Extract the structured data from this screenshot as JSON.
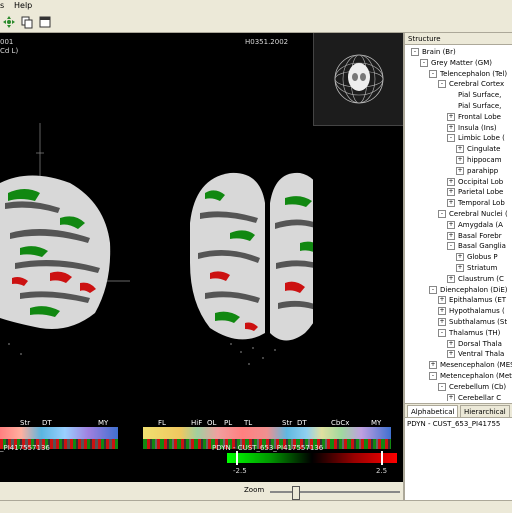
{
  "menu": {
    "items": [
      "s",
      "Help"
    ]
  },
  "viewer": {
    "left_label_top": "001",
    "left_label_sub": "Cd L)",
    "center_label": "H0351.2002",
    "ontology": {
      "left_labels": [
        "Str",
        "DT",
        "MY"
      ],
      "right_labels": [
        "FL",
        "HiF",
        "OL",
        "PL",
        "TL",
        "Str",
        "DT",
        "CbCx",
        "MY"
      ]
    },
    "gene_left": "_PI417557136",
    "gene_right": "PDYN - CUST_653_PI417557136",
    "scale_min": "-2.5",
    "scale_max": "2.5",
    "zoom_label": "Zoom",
    "zoom_level": 0.18
  },
  "panel": {
    "header": "Structure",
    "tree": [
      {
        "label": "Brain (Br)",
        "indent": 0,
        "exp": "-"
      },
      {
        "label": "Grey Matter (GM)",
        "indent": 1,
        "exp": "-"
      },
      {
        "label": "Telencephalon (Tel)",
        "indent": 2,
        "exp": "-"
      },
      {
        "label": "Cerebral Cortex",
        "indent": 3,
        "exp": "-"
      },
      {
        "label": "Pial Surface,",
        "indent": 4,
        "exp": ""
      },
      {
        "label": "Pial Surface,",
        "indent": 4,
        "exp": ""
      },
      {
        "label": "Frontal Lobe",
        "indent": 4,
        "exp": "+"
      },
      {
        "label": "Insula (Ins)",
        "indent": 4,
        "exp": "+"
      },
      {
        "label": "Limbic Lobe (",
        "indent": 4,
        "exp": "-"
      },
      {
        "label": "Cingulate",
        "indent": 5,
        "exp": "+"
      },
      {
        "label": "hippocam",
        "indent": 5,
        "exp": "+"
      },
      {
        "label": "parahipp",
        "indent": 5,
        "exp": "+"
      },
      {
        "label": "Occipital Lob",
        "indent": 4,
        "exp": "+"
      },
      {
        "label": "Parietal Lobe",
        "indent": 4,
        "exp": "+"
      },
      {
        "label": "Temporal Lob",
        "indent": 4,
        "exp": "+"
      },
      {
        "label": "Cerebral Nuclei (",
        "indent": 3,
        "exp": "-"
      },
      {
        "label": "Amygdala (A",
        "indent": 4,
        "exp": "+"
      },
      {
        "label": "Basal Forebr",
        "indent": 4,
        "exp": "+"
      },
      {
        "label": "Basal Ganglia",
        "indent": 4,
        "exp": "-"
      },
      {
        "label": "Globus P",
        "indent": 5,
        "exp": "+"
      },
      {
        "label": "Striatum",
        "indent": 5,
        "exp": "+"
      },
      {
        "label": "Claustrum (C",
        "indent": 4,
        "exp": "+"
      },
      {
        "label": "Diencephalon (DiE)",
        "indent": 2,
        "exp": "-"
      },
      {
        "label": "Epithalamus (ET",
        "indent": 3,
        "exp": "+"
      },
      {
        "label": "Hypothalamus (",
        "indent": 3,
        "exp": "+"
      },
      {
        "label": "Subthalamus (St",
        "indent": 3,
        "exp": "+"
      },
      {
        "label": "Thalamus (TH)",
        "indent": 3,
        "exp": "-"
      },
      {
        "label": "Dorsal Thala",
        "indent": 4,
        "exp": "+"
      },
      {
        "label": "Ventral Thala",
        "indent": 4,
        "exp": "+"
      },
      {
        "label": "Mesencephalon (MES",
        "indent": 2,
        "exp": "+"
      },
      {
        "label": "Metencephalon (Met",
        "indent": 2,
        "exp": "-"
      },
      {
        "label": "Cerebellum (Cb)",
        "indent": 3,
        "exp": "-"
      },
      {
        "label": "Cerebellar C",
        "indent": 4,
        "exp": "+"
      }
    ],
    "tab_alpha": "Alphabetical",
    "tab_hier": "Hierarchical",
    "selection": "PDYN - CUST_653_PI41755"
  },
  "colors": {
    "up": "#cc1111",
    "down": "#118811",
    "cortex": "#d8d8d8"
  }
}
